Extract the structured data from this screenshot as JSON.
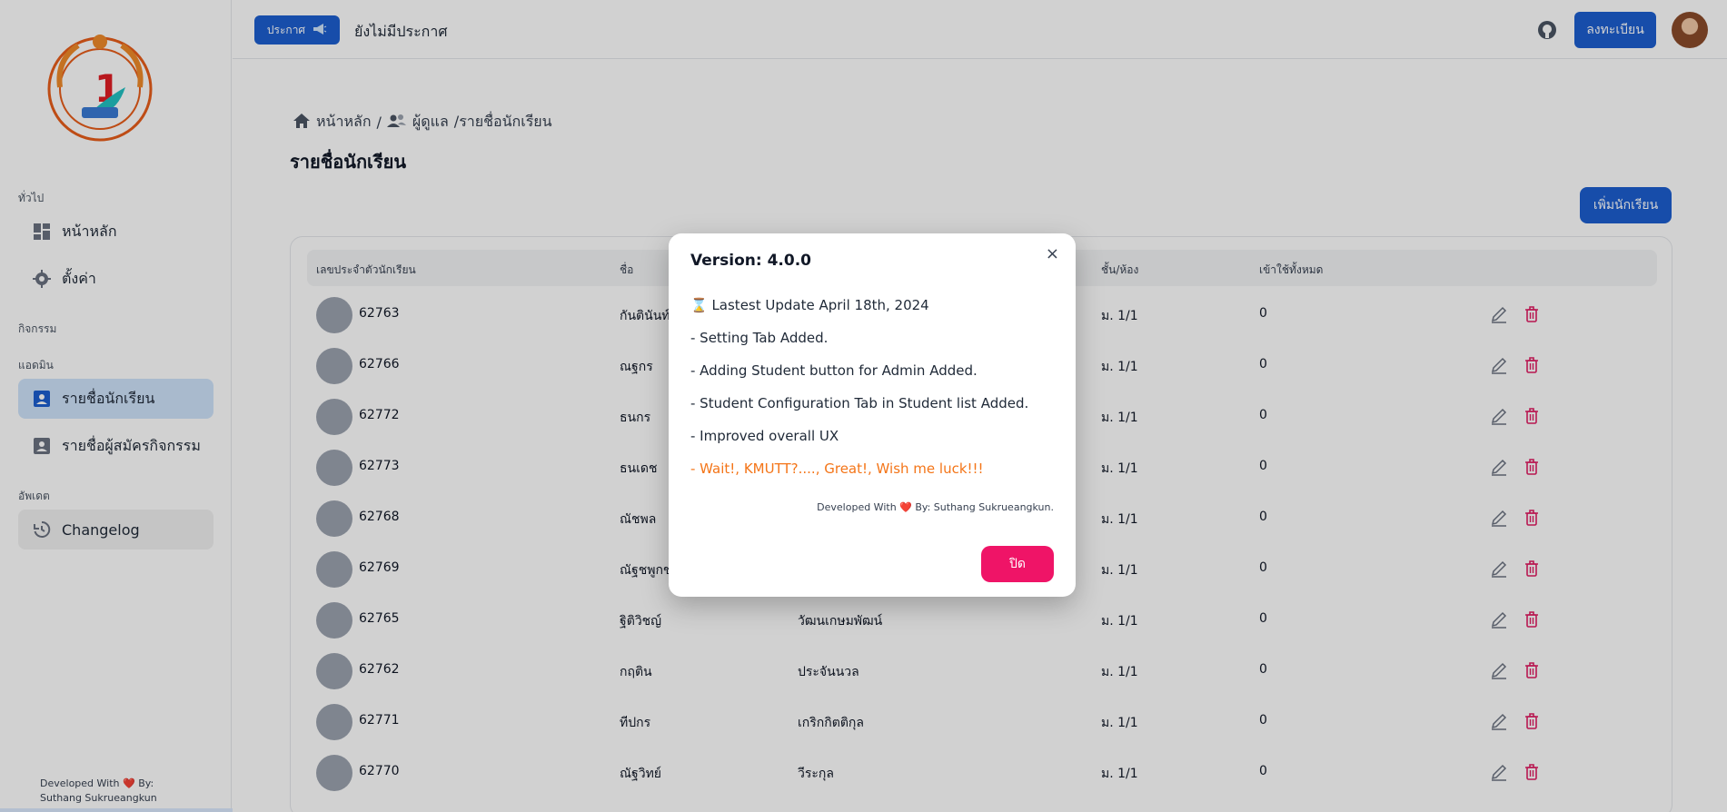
{
  "sidebar": {
    "logo_alt": "1 BE HAPPY",
    "sections": {
      "general": "ทั่วไป",
      "activities": "กิจกรรม",
      "admin": "แอดมิน",
      "update": "อัพเดต"
    },
    "items": {
      "home": "หน้าหลัก",
      "settings": "ตั้งค่า",
      "student_list": "รายชื่อนักเรียน",
      "applicant_list": "รายชื่อผู้สมัครกิจกรรม",
      "changelog": "Changelog"
    },
    "footer_line1": "Developed With ❤️ By:",
    "footer_line2": "Suthang Sukrueangkun"
  },
  "topbar": {
    "announce_label": "ประกาศ",
    "announce_text": "ยังไม่มีประกาศ",
    "register_label": "ลงทะเบียน"
  },
  "main": {
    "breadcrumb": {
      "home": "หน้าหลัก",
      "sep1": "/",
      "admin": "ผู้ดูแล",
      "current": "/รายชื่อนักเรียน"
    },
    "title": "รายชื่อนักเรียน",
    "add_button": "เพิ่มนักเรียน",
    "table": {
      "headers": [
        "เลขประจำตัวนักเรียน",
        "ชื่อ",
        "",
        "ชั้น/ห้อง",
        "เข้าใช้ทั้งหมด"
      ],
      "rows": [
        {
          "id": "62763",
          "first": "กันตินันท์",
          "last": "",
          "class": "ม. 1/1",
          "count": "0"
        },
        {
          "id": "62766",
          "first": "ณฐกร",
          "last": "",
          "class": "ม. 1/1",
          "count": "0"
        },
        {
          "id": "62772",
          "first": "ธนกร",
          "last": "",
          "class": "ม. 1/1",
          "count": "0"
        },
        {
          "id": "62773",
          "first": "ธนเดช",
          "last": "",
          "class": "ม. 1/1",
          "count": "0"
        },
        {
          "id": "62768",
          "first": "ณัชพล",
          "last": "",
          "class": "ม. 1/1",
          "count": "0"
        },
        {
          "id": "62769",
          "first": "ณัฐชพูกช",
          "last": "",
          "class": "ม. 1/1",
          "count": "0"
        },
        {
          "id": "62765",
          "first": "ฐิติวิชญ์",
          "last": "วัฒนเกษมพัฒน์",
          "class": "ม. 1/1",
          "count": "0"
        },
        {
          "id": "62762",
          "first": "กฤติน",
          "last": "ประจันนวล",
          "class": "ม. 1/1",
          "count": "0"
        },
        {
          "id": "62771",
          "first": "ทีปกร",
          "last": "เกริกกิตติกุล",
          "class": "ม. 1/1",
          "count": "0"
        },
        {
          "id": "62770",
          "first": "ณัฐวิทย์",
          "last": "วีระกุล",
          "class": "ม. 1/1",
          "count": "0"
        }
      ]
    }
  },
  "modal": {
    "title": "Version: 4.0.0",
    "lines": [
      "⌛ Lastest Update April 18th, 2024",
      "- Setting Tab Added.",
      "- Adding Student button for Admin Added.",
      "- Student Configuration Tab in Student list Added.",
      "- Improved overall UX",
      "- Wait!, KMUTT?...., Great!, Wish me luck!!!"
    ],
    "developer": "Developed With ❤️ By: Suthang Sukrueangkun.",
    "close_label": "ปิด",
    "close_x": "×"
  },
  "colors": {
    "primary": "#1d5fd0",
    "active_nav": "#cfe3fb",
    "danger": "#ef1467",
    "orange": "#f47518",
    "delete_icon": "#e11d63"
  }
}
